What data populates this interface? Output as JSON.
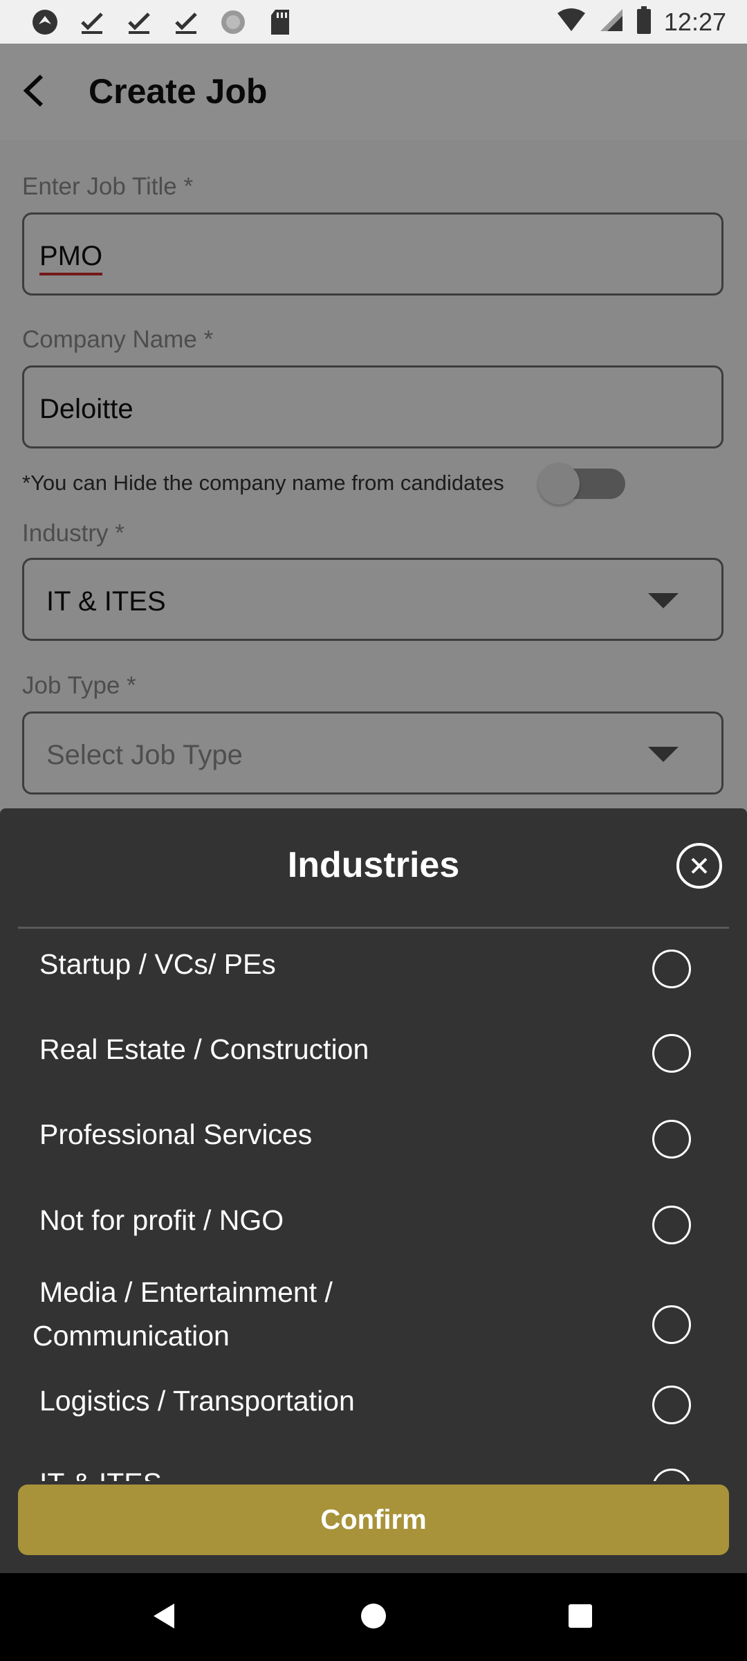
{
  "status_bar": {
    "time": "12:27",
    "left_icons": [
      "app-logo-icon",
      "download-done-icon",
      "download-done-icon",
      "download-done-icon",
      "circle-dots-icon",
      "sd-card-icon"
    ],
    "right_icons": [
      "wifi-icon",
      "signal-icon",
      "battery-icon"
    ]
  },
  "app_bar": {
    "title": "Create Job"
  },
  "form": {
    "job_title": {
      "label": "Enter Job Title *",
      "value": "PMO"
    },
    "company_name": {
      "label": "Company Name *",
      "value": "Deloitte"
    },
    "hide_company_hint": "*You can Hide the company name from candidates",
    "hide_company_toggle": "off",
    "industry": {
      "label": "Industry *",
      "value": "IT & ITES"
    },
    "job_type": {
      "label": "Job Type *",
      "placeholder": "Select Job Type"
    }
  },
  "sheet": {
    "title": "Industries",
    "items": [
      {
        "label": "Startup / VCs/ PEs"
      },
      {
        "label": "Real Estate / Construction"
      },
      {
        "label": "Professional Services"
      },
      {
        "label": "Not for profit / NGO"
      },
      {
        "label_line1": "Media / Entertainment /",
        "label_line2": "Communication"
      },
      {
        "label": "Logistics / Transportation"
      },
      {
        "label": "IT & ITES"
      }
    ],
    "confirm_label": "Confirm"
  },
  "colors": {
    "sheet_bg": "#333333",
    "confirm_bg": "#a8933a",
    "spell_underline": "#d32f2f"
  },
  "nav_bar": {
    "icons": [
      "back-triangle-icon",
      "home-circle-icon",
      "recents-square-icon"
    ]
  }
}
